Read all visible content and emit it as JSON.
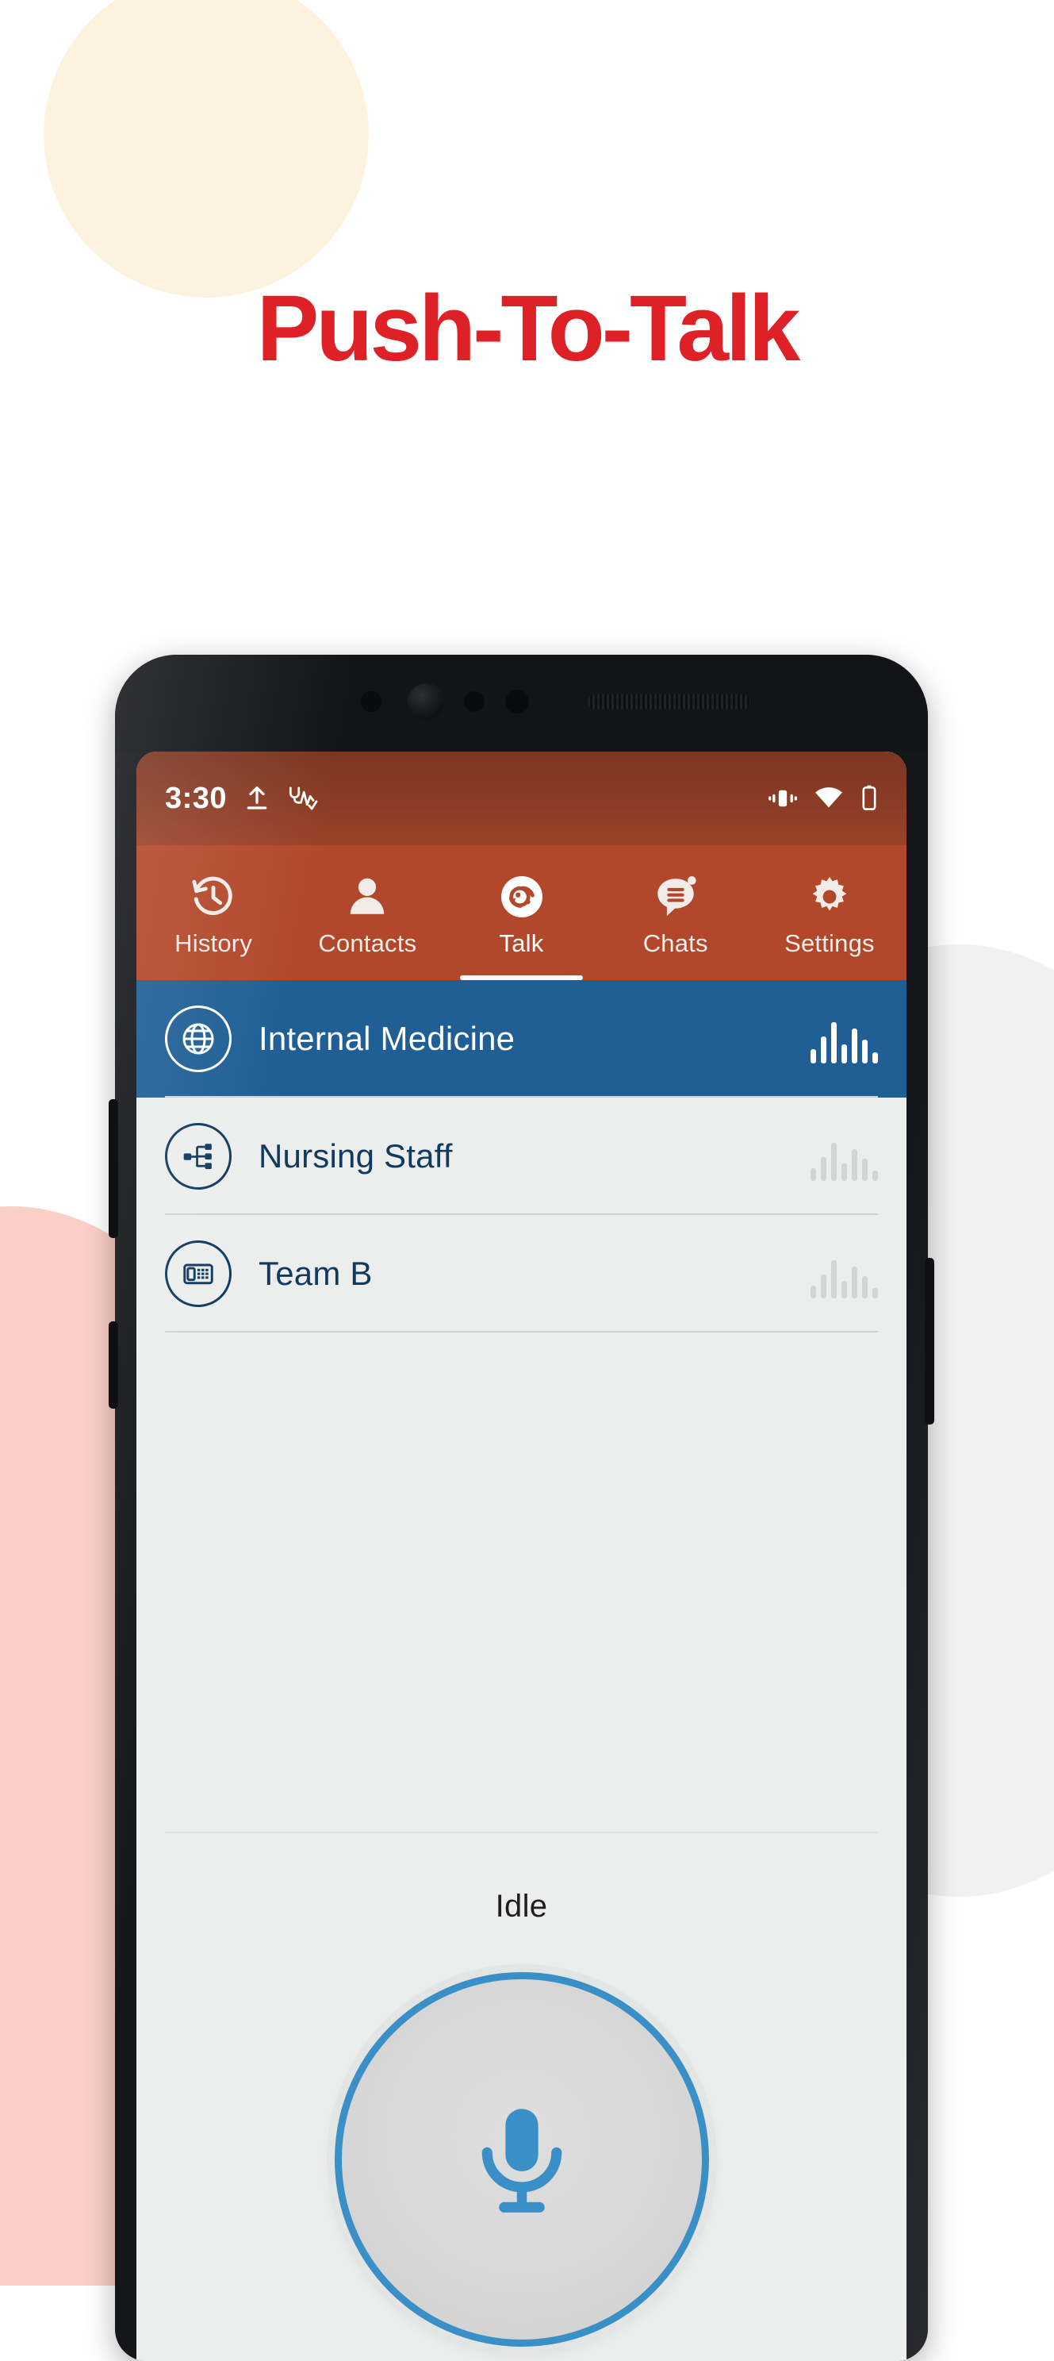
{
  "headline": {
    "text": "Push-To-Talk"
  },
  "colors": {
    "headline_red": "#de2027",
    "statusbar_brown": "#8b3c25",
    "tabbar_orange": "#b2482b",
    "selected_blue": "#1f5f96",
    "accent_blue": "#3b8fc7",
    "icon_navy": "#123a5e",
    "screen_bg": "#eceded",
    "blob_cream": "#fdf2dd",
    "blob_pink": "#f9cfc6",
    "blob_gray": "#f1f1f1"
  },
  "phone": {
    "statusbar": {
      "time": "3:30",
      "left_icons": [
        "upload-icon",
        "stethoscope-icon"
      ],
      "right_icons": [
        "vibrate-icon",
        "wifi-icon",
        "battery-icon"
      ]
    },
    "tabs": [
      {
        "label": "History",
        "icon": "history-clock-icon",
        "active": false,
        "badge": false
      },
      {
        "label": "Contacts",
        "icon": "person-icon",
        "active": false,
        "badge": false
      },
      {
        "label": "Talk",
        "icon": "walkie-talkie-icon",
        "active": true,
        "badge": false
      },
      {
        "label": "Chats",
        "icon": "chat-bubble-icon",
        "active": false,
        "badge": true
      },
      {
        "label": "Settings",
        "icon": "gear-icon",
        "active": false,
        "badge": false
      }
    ],
    "channels": [
      {
        "name": "Internal Medicine",
        "icon": "globe-icon",
        "selected": true,
        "waveform": "active"
      },
      {
        "name": "Nursing Staff",
        "icon": "network-icon",
        "selected": false,
        "waveform": "inactive"
      },
      {
        "name": "Team B",
        "icon": "deskphone-icon",
        "selected": false,
        "waveform": "inactive"
      }
    ],
    "ptt": {
      "status_label": "Idle",
      "button_icon": "microphone-icon"
    }
  }
}
